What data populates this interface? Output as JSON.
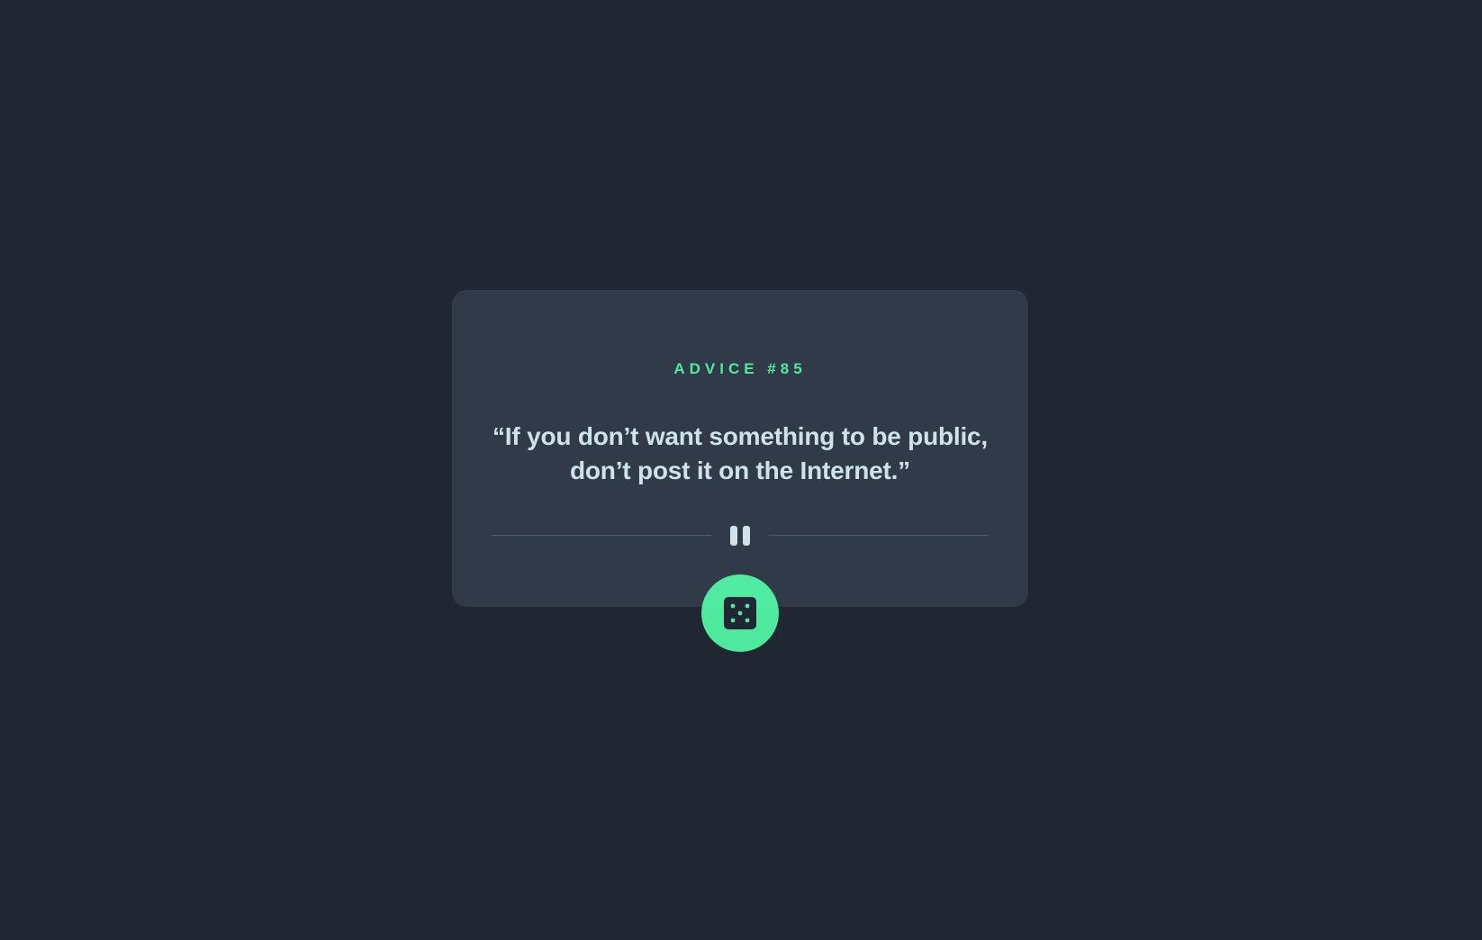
{
  "card": {
    "heading": "ADVICE #85",
    "quote": "“If you don’t want something to be public, don’t post it on the Internet.”"
  },
  "divider": {
    "icon": "pause-icon"
  },
  "actions": {
    "dice_button_icon": "dice-icon"
  },
  "colors": {
    "background": "#202733",
    "card": "#313a48",
    "accent": "#53ffaa",
    "text": "#cee3e9",
    "divider": "#4f5d74"
  }
}
